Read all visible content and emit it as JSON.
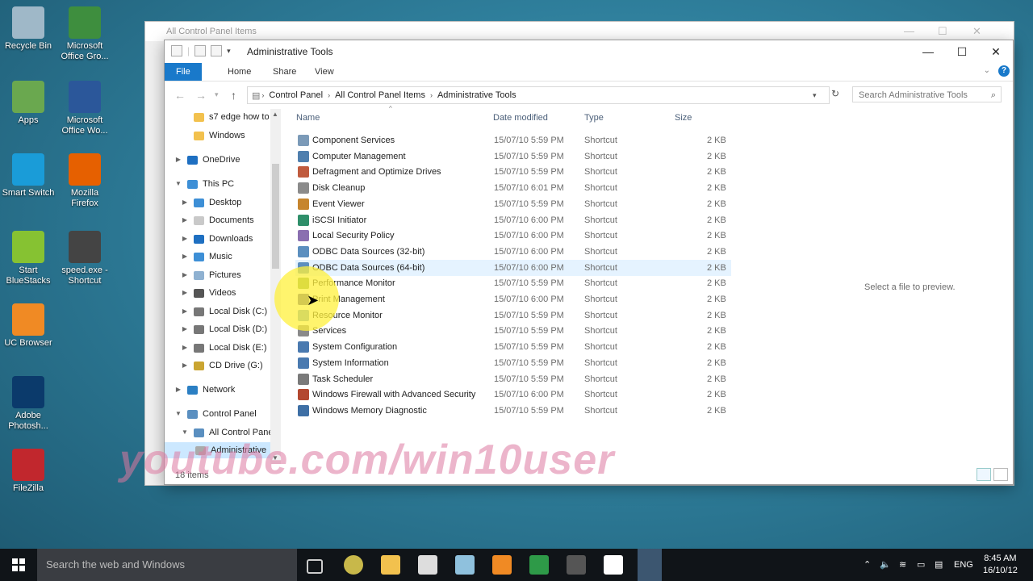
{
  "desktop": {
    "icons": [
      {
        "label": "Recycle Bin",
        "icon": "recycle-bin-icon",
        "color": "#9fb8c8"
      },
      {
        "label": "Microsoft Office Gro...",
        "icon": "office-groove-icon",
        "color": "#3e8e3e"
      },
      {
        "label": "Apps",
        "icon": "apps-icon",
        "color": "#6aa84f"
      },
      {
        "label": "Microsoft Office Wo...",
        "icon": "word-icon",
        "color": "#2b579a"
      },
      {
        "label": "Smart Switch",
        "icon": "smart-switch-icon",
        "color": "#1a9cd8"
      },
      {
        "label": "Mozilla Firefox",
        "icon": "firefox-icon",
        "color": "#e66000"
      },
      {
        "label": "Start BlueStacks",
        "icon": "bluestacks-icon",
        "color": "#86c232"
      },
      {
        "label": "speed.exe - Shortcut",
        "icon": "nfs-icon",
        "color": "#444444"
      },
      {
        "label": "UC Browser",
        "icon": "uc-browser-icon",
        "color": "#f08a24"
      },
      {
        "label": "Adobe Photosh...",
        "icon": "photoshop-icon",
        "color": "#0b3a6b"
      },
      {
        "label": "FileZilla",
        "icon": "filezilla-icon",
        "color": "#c1272d"
      }
    ]
  },
  "bg_window": {
    "title": "All Control Panel Items"
  },
  "window": {
    "title": "Administrative Tools",
    "ribbon_tabs": [
      "File",
      "Home",
      "Share",
      "View"
    ],
    "breadcrumbs": [
      "Control Panel",
      "All Control Panel Items",
      "Administrative Tools"
    ],
    "search_placeholder": "Search Administrative Tools",
    "columns": {
      "name": "Name",
      "date": "Date modified",
      "type": "Type",
      "size": "Size"
    },
    "nav": [
      {
        "label": "s7 edge how to",
        "icon": "folder-icon"
      },
      {
        "label": "Windows",
        "icon": "folder-icon"
      },
      {
        "label": "OneDrive",
        "icon": "onedrive-icon"
      },
      {
        "label": "This PC",
        "icon": "pc-icon"
      },
      {
        "label": "Desktop",
        "icon": "desktop-icon"
      },
      {
        "label": "Documents",
        "icon": "documents-icon"
      },
      {
        "label": "Downloads",
        "icon": "downloads-icon"
      },
      {
        "label": "Music",
        "icon": "music-icon"
      },
      {
        "label": "Pictures",
        "icon": "pictures-icon"
      },
      {
        "label": "Videos",
        "icon": "videos-icon"
      },
      {
        "label": "Local Disk (C:)",
        "icon": "drive-icon"
      },
      {
        "label": "Local Disk (D:)",
        "icon": "drive-icon"
      },
      {
        "label": "Local Disk (E:)",
        "icon": "drive-icon"
      },
      {
        "label": "CD Drive (G:)",
        "icon": "cd-drive-icon"
      },
      {
        "label": "Network",
        "icon": "network-icon"
      },
      {
        "label": "Control Panel",
        "icon": "control-panel-icon"
      },
      {
        "label": "All Control Pane",
        "icon": "control-panel-icon"
      },
      {
        "label": "Administrative",
        "icon": "admin-tools-icon"
      }
    ],
    "files": [
      {
        "name": "Component Services",
        "date": "15/07/10 5:59 PM",
        "type": "Shortcut",
        "size": "2 KB"
      },
      {
        "name": "Computer Management",
        "date": "15/07/10 5:59 PM",
        "type": "Shortcut",
        "size": "2 KB"
      },
      {
        "name": "Defragment and Optimize Drives",
        "date": "15/07/10 5:59 PM",
        "type": "Shortcut",
        "size": "2 KB"
      },
      {
        "name": "Disk Cleanup",
        "date": "15/07/10 6:01 PM",
        "type": "Shortcut",
        "size": "2 KB"
      },
      {
        "name": "Event Viewer",
        "date": "15/07/10 5:59 PM",
        "type": "Shortcut",
        "size": "2 KB"
      },
      {
        "name": "iSCSI Initiator",
        "date": "15/07/10 6:00 PM",
        "type": "Shortcut",
        "size": "2 KB"
      },
      {
        "name": "Local Security Policy",
        "date": "15/07/10 6:00 PM",
        "type": "Shortcut",
        "size": "2 KB"
      },
      {
        "name": "ODBC Data Sources (32-bit)",
        "date": "15/07/10 6:00 PM",
        "type": "Shortcut",
        "size": "2 KB"
      },
      {
        "name": "ODBC Data Sources (64-bit)",
        "date": "15/07/10 6:00 PM",
        "type": "Shortcut",
        "size": "2 KB"
      },
      {
        "name": "Performance Monitor",
        "date": "15/07/10 5:59 PM",
        "type": "Shortcut",
        "size": "2 KB"
      },
      {
        "name": "Print Management",
        "date": "15/07/10 6:00 PM",
        "type": "Shortcut",
        "size": "2 KB"
      },
      {
        "name": "Resource Monitor",
        "date": "15/07/10 5:59 PM",
        "type": "Shortcut",
        "size": "2 KB"
      },
      {
        "name": "Services",
        "date": "15/07/10 5:59 PM",
        "type": "Shortcut",
        "size": "2 KB"
      },
      {
        "name": "System Configuration",
        "date": "15/07/10 5:59 PM",
        "type": "Shortcut",
        "size": "2 KB"
      },
      {
        "name": "System Information",
        "date": "15/07/10 5:59 PM",
        "type": "Shortcut",
        "size": "2 KB"
      },
      {
        "name": "Task Scheduler",
        "date": "15/07/10 5:59 PM",
        "type": "Shortcut",
        "size": "2 KB"
      },
      {
        "name": "Windows Firewall with Advanced Security",
        "date": "15/07/10 6:00 PM",
        "type": "Shortcut",
        "size": "2 KB"
      },
      {
        "name": "Windows Memory Diagnostic",
        "date": "15/07/10 5:59 PM",
        "type": "Shortcut",
        "size": "2 KB"
      }
    ],
    "preview_text": "Select a file to preview.",
    "status": "18 items"
  },
  "watermark": "youtube.com/win10user",
  "taskbar": {
    "search_placeholder": "Search the web and Windows",
    "language": "ENG",
    "time": "8:45 AM",
    "date": "16/10/12"
  }
}
